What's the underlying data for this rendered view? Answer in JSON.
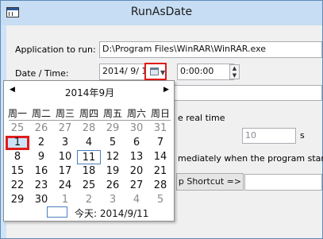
{
  "window": {
    "title": "RunAsDate",
    "icon": "app-window-icon"
  },
  "form": {
    "app_label": "Application to run:",
    "app_path": "D:\\Program Files\\WinRAR\\WinRAR.exe",
    "datetime_label": "Date / Time:",
    "date_value": "2014/  9/  1",
    "time_value": "0:00:00",
    "realtime_label": "e real time",
    "interval_value": "10",
    "interval_unit": "s",
    "immediate_label": "mediately when the program starts",
    "shortcut_button": "p Shortcut =>"
  },
  "calendar": {
    "title": "2014年9月",
    "prev": "◀",
    "next": "▶",
    "weekdays": [
      "周一",
      "周二",
      "周三",
      "周四",
      "周五",
      "周六",
      "周日"
    ],
    "weeks": [
      [
        "25",
        "26",
        "27",
        "28",
        "29",
        "30",
        "31"
      ],
      [
        "1",
        "2",
        "3",
        "4",
        "5",
        "6",
        "7"
      ],
      [
        "8",
        "9",
        "10",
        "11",
        "12",
        "13",
        "14"
      ],
      [
        "15",
        "16",
        "17",
        "18",
        "19",
        "20",
        "21"
      ],
      [
        "22",
        "23",
        "24",
        "25",
        "26",
        "27",
        "28"
      ],
      [
        "29",
        "30",
        "1",
        "2",
        "3",
        "4",
        "5"
      ]
    ],
    "selected_day": "1",
    "today_day": "11",
    "today_label": "今天: 2014/9/11"
  }
}
